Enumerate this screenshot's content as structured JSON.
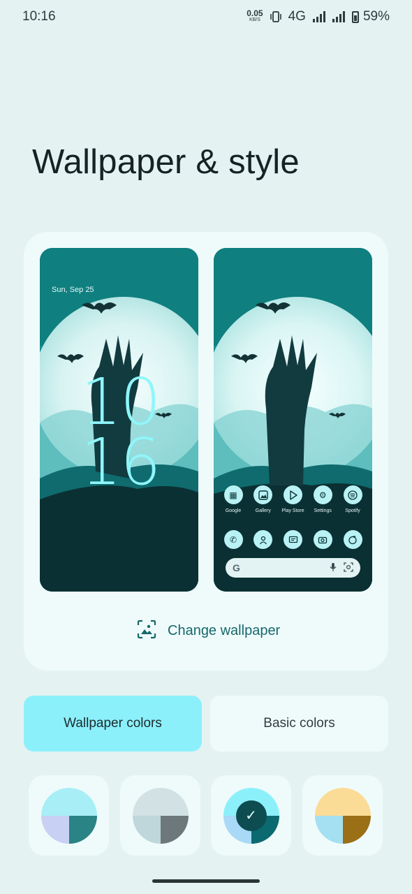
{
  "status_bar": {
    "time": "10:16",
    "net_speed_value": "0.05",
    "net_speed_unit": "KB/S",
    "network": "4G",
    "battery": "59%"
  },
  "page": {
    "title": "Wallpaper & style"
  },
  "preview": {
    "lock_screen": {
      "date": "Sun, Sep 25",
      "clock_hours": "10",
      "clock_minutes": "16"
    },
    "home_screen": {
      "apps_row1": [
        {
          "label": "Google",
          "icon": "google-folder-icon"
        },
        {
          "label": "Gallery",
          "icon": "gallery-icon"
        },
        {
          "label": "Play Store",
          "icon": "play-store-icon"
        },
        {
          "label": "Settings",
          "icon": "settings-icon"
        },
        {
          "label": "Spotify",
          "icon": "spotify-icon"
        }
      ],
      "apps_row2": [
        {
          "icon": "phone-icon"
        },
        {
          "icon": "contacts-icon"
        },
        {
          "icon": "messages-icon"
        },
        {
          "icon": "camera-icon"
        },
        {
          "icon": "browser-icon"
        }
      ],
      "search_bar": {
        "logo": "G"
      }
    },
    "change_wallpaper_label": "Change wallpaper"
  },
  "tabs": {
    "wallpaper_colors": "Wallpaper colors",
    "basic_colors": "Basic colors",
    "selected": "wallpaper_colors"
  },
  "color_options": [
    {
      "top": "#a8eef6",
      "bottom_left": "#c8d0f3",
      "bottom_right": "#2a8385",
      "selected": false
    },
    {
      "top": "#d2e2e4",
      "bottom_left": "#bfd6da",
      "bottom_right": "#6c7879",
      "selected": false
    },
    {
      "top": "#8cf0fb",
      "bottom_left": "#a8d9f7",
      "bottom_right": "#0a6a70",
      "selected": true
    },
    {
      "top": "#fbdc96",
      "bottom_left": "#a5e0f2",
      "bottom_right": "#9a6f16",
      "selected": false
    }
  ],
  "colors": {
    "background": "#e4f2f2",
    "card": "#effbfb",
    "accent": "#8cf0fb",
    "link": "#17676b"
  }
}
